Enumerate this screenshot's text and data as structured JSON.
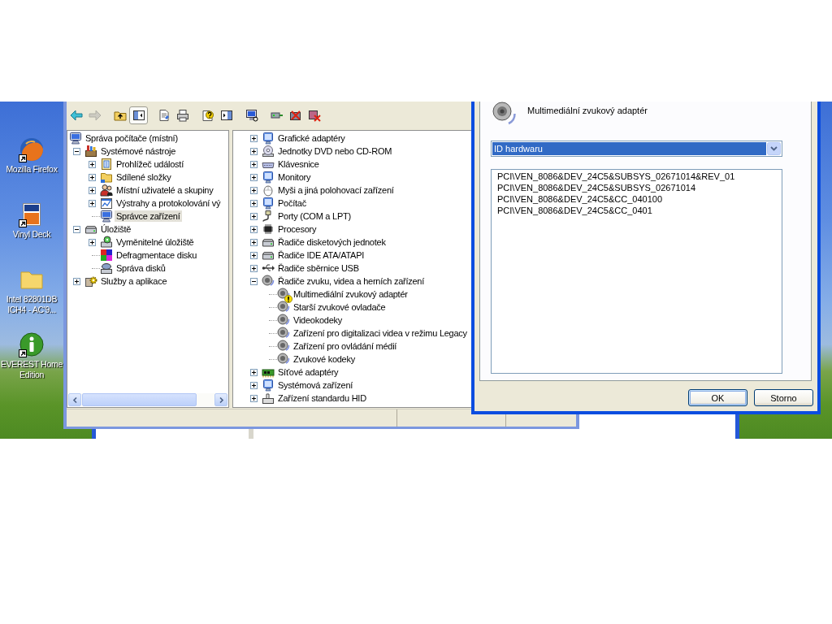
{
  "desktop": {
    "shortcuts": [
      {
        "label": "Mozilla Firefox",
        "shortcut": true
      },
      {
        "label": "Vinyl Deck",
        "shortcut": true
      },
      {
        "label": "Intel 82801DB ICH4 - AC'9...",
        "shortcut": false
      },
      {
        "label": "EVEREST Home Edition",
        "shortcut": true
      }
    ]
  },
  "toolbar": {
    "groups": [
      [
        {
          "disabled": false,
          "pressed": false
        },
        {
          "disabled": true,
          "pressed": false
        }
      ],
      [
        {
          "disabled": false,
          "pressed": false
        },
        {
          "disabled": false,
          "pressed": true
        }
      ],
      [
        {
          "disabled": false,
          "pressed": false
        },
        {
          "disabled": false,
          "pressed": false
        }
      ],
      [
        {
          "disabled": false,
          "pressed": false
        },
        {
          "disabled": false,
          "pressed": false
        }
      ],
      [
        {
          "disabled": false,
          "pressed": false
        }
      ],
      [
        {
          "disabled": false,
          "pressed": false
        },
        {
          "disabled": false,
          "pressed": false
        },
        {
          "disabled": false,
          "pressed": false
        }
      ]
    ]
  },
  "left_tree": {
    "items": [
      {
        "label": "Správa počítače (místní)",
        "selected": false,
        "children": [
          {
            "label": "Systémové nástroje",
            "expanded": true,
            "selected": false,
            "children": [
              {
                "label": "Prohlížeč událostí",
                "expanded": false,
                "selected": false
              },
              {
                "label": "Sdílené složky",
                "expanded": false,
                "selected": false
              },
              {
                "label": "Místní uživatelé a skupiny",
                "expanded": false,
                "selected": false
              },
              {
                "label": "Výstrahy a protokolování vý",
                "expanded": false,
                "selected": false
              },
              {
                "label": "Správce zařízení",
                "selected": true
              }
            ]
          },
          {
            "label": "Úložiště",
            "expanded": true,
            "selected": false,
            "children": [
              {
                "label": "Vyměnitelné úložiště",
                "expanded": false,
                "selected": false
              },
              {
                "label": "Defragmentace disku",
                "selected": false
              },
              {
                "label": "Správa disků",
                "selected": false
              }
            ]
          },
          {
            "label": "Služby a aplikace",
            "expanded": false,
            "selected": false
          }
        ]
      }
    ]
  },
  "right_tree": {
    "items": [
      {
        "label": "Grafické adaptéry",
        "expanded": false,
        "selected": false
      },
      {
        "label": "Jednotky DVD nebo CD-ROM",
        "expanded": false,
        "selected": false
      },
      {
        "label": "Klávesnice",
        "expanded": false,
        "selected": false
      },
      {
        "label": "Monitory",
        "expanded": false,
        "selected": false
      },
      {
        "label": "Myši a jiná polohovací zařízení",
        "expanded": false,
        "selected": false
      },
      {
        "label": "Počítač",
        "expanded": false,
        "selected": false
      },
      {
        "label": "Porty (COM a LPT)",
        "expanded": false,
        "selected": false
      },
      {
        "label": "Procesory",
        "expanded": false,
        "selected": false
      },
      {
        "label": "Řadiče disketových jednotek",
        "expanded": false,
        "selected": false
      },
      {
        "label": "Řadiče IDE ATA/ATAPI",
        "expanded": false,
        "selected": false
      },
      {
        "label": "Řadiče sběrnice USB",
        "expanded": false,
        "selected": false
      },
      {
        "label": "Řadiče zvuku, videa a herních zařízení",
        "expanded": true,
        "selected": false,
        "children": [
          {
            "label": "Multimediální zvukový adaptér",
            "selected": false,
            "warning": true
          },
          {
            "label": "Starší zvukové ovladače",
            "selected": false,
            "warning": false
          },
          {
            "label": "Videokodeky",
            "selected": false,
            "warning": false
          },
          {
            "label": "Zařízení pro digitalizaci videa v režimu Legacy",
            "selected": false,
            "warning": false
          },
          {
            "label": "Zařízení pro ovládání médií",
            "selected": false,
            "warning": false
          },
          {
            "label": "Zvukové kodeky",
            "selected": false,
            "warning": false
          }
        ]
      },
      {
        "label": "Síťové adaptéry",
        "expanded": false,
        "selected": false
      },
      {
        "label": "Systémová zařízení",
        "expanded": false,
        "selected": false
      },
      {
        "label": "Zařízení standardu HID",
        "expanded": false,
        "selected": false
      }
    ]
  },
  "dialog": {
    "device_name": "Multimediální zvukový adaptér",
    "property": {
      "value": "ID hardwaru",
      "focused": true
    },
    "values": [
      "PCI\\VEN_8086&DEV_24C5&SUBSYS_02671014&REV_01",
      "PCI\\VEN_8086&DEV_24C5&SUBSYS_02671014",
      "PCI\\VEN_8086&DEV_24C5&CC_040100",
      "PCI\\VEN_8086&DEV_24C5&CC_0401"
    ],
    "buttons": [
      {
        "label": "OK",
        "default": true
      },
      {
        "label": "Storno",
        "default": false
      }
    ]
  }
}
